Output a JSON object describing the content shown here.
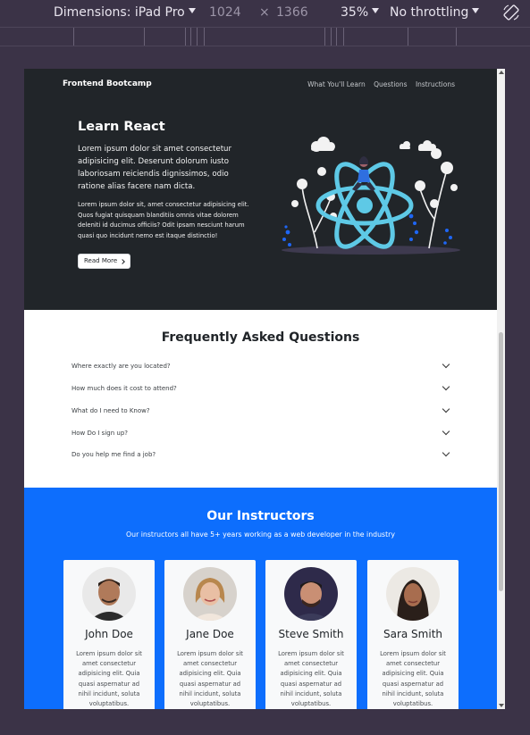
{
  "devtools": {
    "device_label": "Dimensions: iPad Pro",
    "width": "1024",
    "times": "×",
    "height": "1366",
    "zoom": "35%",
    "throttling": "No throttling"
  },
  "nav": {
    "brand": "Frontend Bootcamp",
    "links": [
      "What You'll Learn",
      "Questions",
      "Instructions"
    ]
  },
  "hero": {
    "title": "Learn React",
    "lead": "Lorem ipsum dolor sit amet consectetur adipisicing elit. Deserunt dolorum iusto laboriosam reiciendis dignissimos, odio ratione alias facere nam dicta.",
    "text": "Lorem ipsum dolor sit, amet consectetur adipisicing elit. Quos fugiat quisquam blanditiis omnis vitae dolorem deleniti id ducimus officiis? Odit ipsam nesciunt harum quasi quo incidunt nemo est itaque distinctio!",
    "button": "Read More"
  },
  "faq": {
    "title": "Frequently Asked Questions",
    "questions": [
      "Where exactly are you located?",
      "How much does it cost to attend?",
      "What do I need to Know?",
      "How Do I sign up?",
      "Do you help me find a job?"
    ]
  },
  "instructors": {
    "title": "Our Instructors",
    "subtitle": "Our instructors all have 5+ years working as a web developer in the industry",
    "cards": [
      {
        "name": "John Doe",
        "text": "Lorem ipsum dolor sit amet consectetur adipisicing elit. Quia quasi aspernatur ad nihil incidunt, soluta voluptatibus."
      },
      {
        "name": "Jane Doe",
        "text": "Lorem ipsum dolor sit amet consectetur adipisicing elit. Quia quasi aspernatur ad nihil incidunt, soluta voluptatibus."
      },
      {
        "name": "Steve Smith",
        "text": "Lorem ipsum dolor sit amet consectetur adipisicing elit. Quia quasi aspernatur ad nihil incidunt, soluta voluptatibus."
      },
      {
        "name": "Sara Smith",
        "text": "Lorem ipsum dolor sit amet consectetur adipisicing elit. Quia quasi aspernatur ad nihil incidunt, soluta voluptatibus."
      }
    ]
  },
  "colors": {
    "hero_bg": "#212529",
    "brand_blue": "#0d6efd",
    "react_cyan": "#5ec9e6"
  },
  "icons": [
    "caret-down-icon",
    "rotate-device-icon",
    "chevron-right-icon",
    "chevron-down-icon",
    "react-logo-icon"
  ]
}
